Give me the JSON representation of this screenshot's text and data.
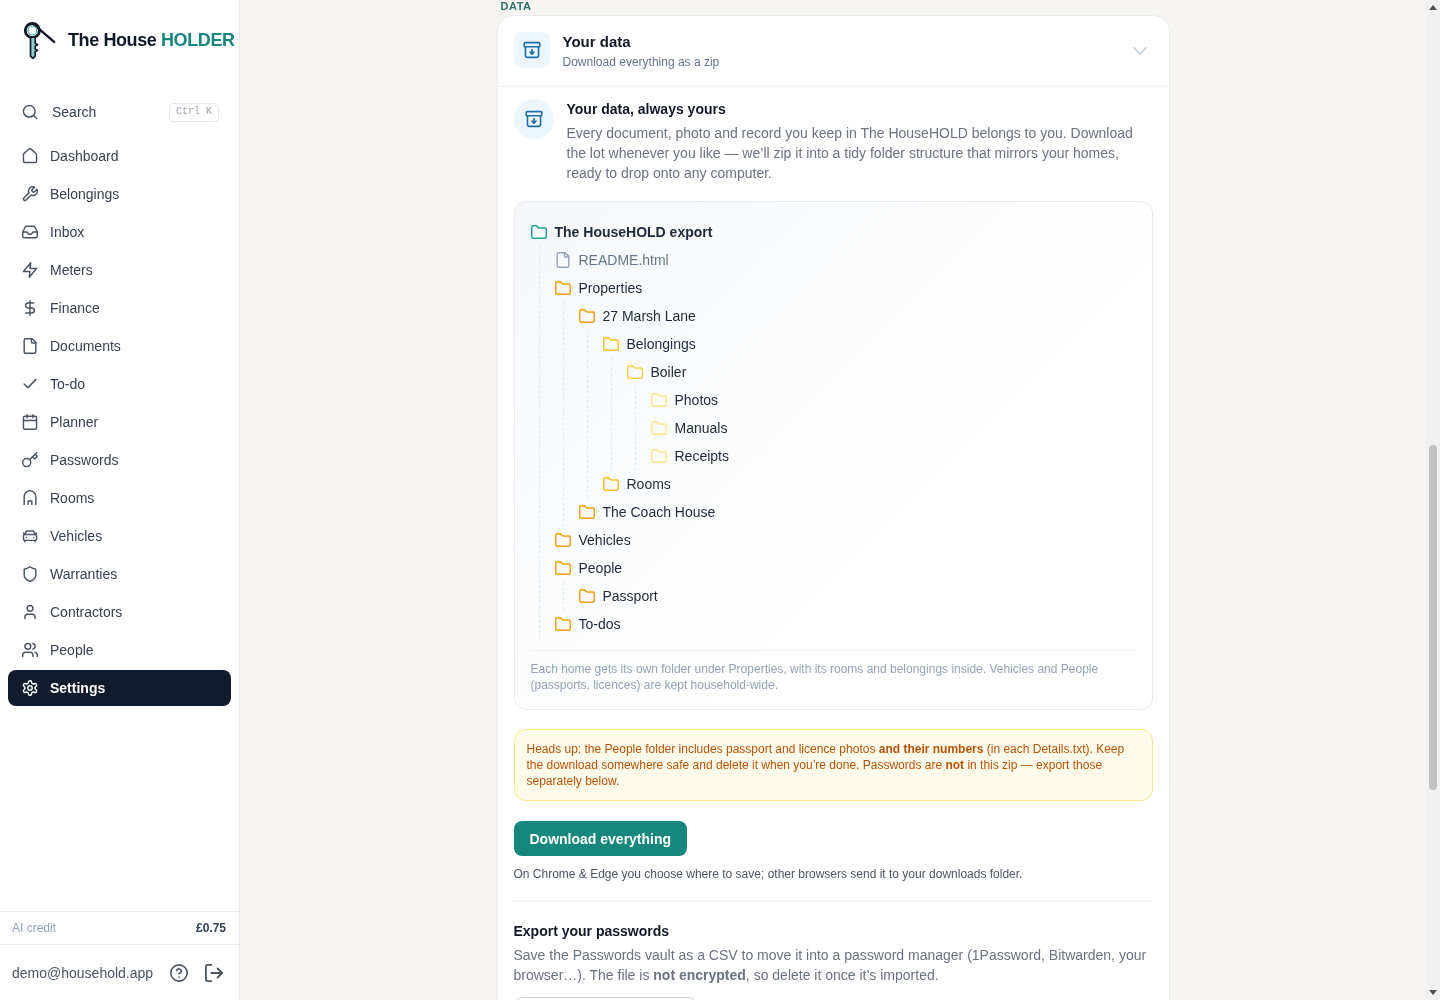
{
  "sidebar": {
    "logo": {
      "text": "The House",
      "accent": "HOLDER"
    },
    "search": {
      "label": "Search",
      "shortcut": "Ctrl K"
    },
    "nav": [
      {
        "label": "Dashboard",
        "selected": false
      },
      {
        "label": "Belongings",
        "selected": false
      },
      {
        "label": "Inbox",
        "selected": false
      },
      {
        "label": "Meters",
        "selected": false
      },
      {
        "label": "Finance",
        "selected": false
      },
      {
        "label": "Documents",
        "selected": false
      },
      {
        "label": "To-do",
        "selected": false
      },
      {
        "label": "Planner",
        "selected": false
      },
      {
        "label": "Passwords",
        "selected": false
      },
      {
        "label": "Rooms",
        "selected": false
      },
      {
        "label": "Vehicles",
        "selected": false
      },
      {
        "label": "Warranties",
        "selected": false
      },
      {
        "label": "Contractors",
        "selected": false
      },
      {
        "label": "People",
        "selected": false
      },
      {
        "label": "Settings",
        "selected": true
      }
    ],
    "credit": {
      "label": "AI credit",
      "value": "£0.75"
    },
    "account": {
      "email": "demo@household.app"
    }
  },
  "section_label": "DATA",
  "card": {
    "title": "Your data",
    "subtitle": "Download everything as a zip",
    "expanded": true,
    "intro": {
      "title": "Your data, always yours",
      "text": "Every document, photo and record you keep in The HouseHOLD belongs to you. Download the lot whenever you like — we’ll zip it into a tidy folder structure that mirrors your homes, ready to drop onto any computer."
    },
    "tree": {
      "label": "The HouseHOLD export",
      "kind": "folder",
      "children": [
        {
          "label": "README.html",
          "kind": "file"
        },
        {
          "label": "Properties",
          "kind": "folder",
          "children": [
            {
              "label": "27 Marsh Lane",
              "kind": "folder",
              "children": [
                {
                  "label": "Belongings",
                  "kind": "folder",
                  "children": [
                    {
                      "label": "Boiler",
                      "kind": "folder",
                      "children": [
                        {
                          "label": "Photos",
                          "kind": "folder"
                        },
                        {
                          "label": "Manuals",
                          "kind": "folder"
                        },
                        {
                          "label": "Receipts",
                          "kind": "folder"
                        }
                      ]
                    }
                  ]
                },
                {
                  "label": "Rooms",
                  "kind": "folder"
                }
              ]
            },
            {
              "label": "The Coach House",
              "kind": "folder"
            }
          ]
        },
        {
          "label": "Vehicles",
          "kind": "folder"
        },
        {
          "label": "People",
          "kind": "folder",
          "children": [
            {
              "label": "Passport",
              "kind": "folder"
            }
          ]
        },
        {
          "label": "To-dos",
          "kind": "folder"
        }
      ]
    },
    "tree_caption": "Each home gets its own folder under Properties, with its rooms and belongings inside. Vehicles and People (passports, licences) are kept household-wide.",
    "warning": "Heads up: the People folder includes passport and licence photos **and their numbers** (in each Details.txt). Keep the download somewhere safe and delete it when you’re done. Passwords are **not** in this zip — export those separately below.",
    "download_button": "Download everything",
    "download_note": "On Chrome & Edge you choose where to save; other browsers send it to your downloads folder.",
    "passwords": {
      "title": "Export your passwords",
      "text": "Save the Passwords vault as a CSV to move it into a password manager (1Password, Bitwarden, your browser…). The file is **not encrypted**, so delete it once it’s imported."
    }
  }
}
